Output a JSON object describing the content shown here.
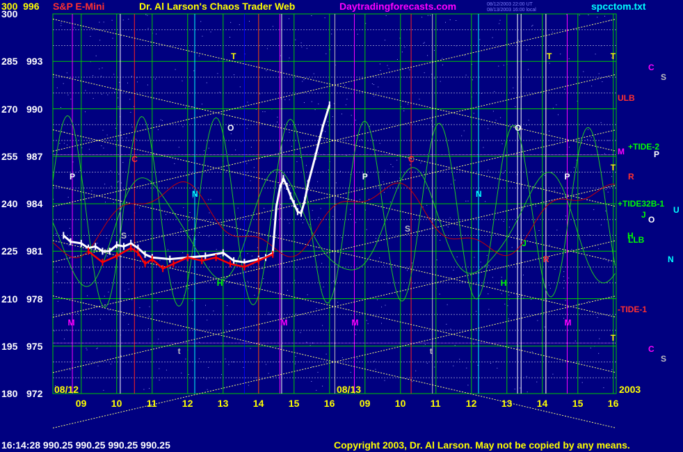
{
  "header": {
    "symbol": "S&P E-Mini",
    "title": "Dr. Al Larson's Chaos Trader Web",
    "site": "Daytradingforecasts.com",
    "stamp_line1": "08/12/2003 22:00 UT",
    "stamp_line2": "08/13/2003 16:00 local",
    "file": "spcctom.txt"
  },
  "footer": {
    "quote": "16:14:28 990.25 990.25 990.25 990.25",
    "copyright": "Copyright 2003, Dr. Al Larson. May not be copied by any means."
  },
  "colors": {
    "background": "#000080",
    "grid_green": "#00cc00",
    "diagonal_yellow": "#ffff80",
    "price_bars": "#ffffff",
    "average_yellow": "#ffff00",
    "red_price": "#ff0000",
    "tide_green": "#22cc22",
    "red_flux": "#cc0000"
  },
  "chart_data": {
    "type": "line",
    "y_left_labels": [
      "300",
      "285",
      "270",
      "255",
      "240",
      "225",
      "210",
      "195",
      "180"
    ],
    "y_right_labels": [
      "996",
      "993",
      "990",
      "987",
      "984",
      "981",
      "978",
      "975",
      "972"
    ],
    "ylim": [
      972,
      996
    ],
    "x_hour_labels": [
      "09",
      "10",
      "11",
      "12",
      "13",
      "14",
      "15",
      "16",
      "09",
      "10",
      "11",
      "12",
      "13",
      "14",
      "15",
      "16"
    ],
    "date_labels": [
      "08/12",
      "08/13"
    ],
    "year_label": "2003",
    "series": [
      {
        "color": "#ffffff",
        "x": [
          8.5,
          8.7,
          9.0,
          9.2,
          9.4,
          9.6,
          9.8,
          10.0,
          10.2,
          10.4,
          10.6,
          10.8,
          11.0,
          11.5,
          12.0,
          12.5,
          13.0,
          13.3,
          13.6,
          14.0,
          14.2,
          14.4,
          14.5,
          14.6,
          14.7,
          14.8,
          14.9,
          15.0,
          15.1,
          15.2,
          15.3,
          15.4,
          15.6,
          15.8,
          16.0
        ],
        "y": [
          982.0,
          981.6,
          981.5,
          981.2,
          981.3,
          981.0,
          981.0,
          981.4,
          981.3,
          981.5,
          981.2,
          980.8,
          980.6,
          980.5,
          980.6,
          980.7,
          980.9,
          980.4,
          980.3,
          980.5,
          980.6,
          980.9,
          983.8,
          985.0,
          985.6,
          985.1,
          984.5,
          984.0,
          983.5,
          983.4,
          984.2,
          985.3,
          987.0,
          988.8,
          990.25
        ]
      },
      {
        "color": "#ff0000",
        "x": [
          9.2,
          9.6,
          10.0,
          10.4,
          10.6,
          10.8,
          11.0,
          11.3,
          11.6,
          12.0,
          12.4,
          12.8,
          13.2,
          13.6,
          14.0,
          14.4
        ],
        "y": [
          981.0,
          980.3,
          980.7,
          981.2,
          980.9,
          980.2,
          980.5,
          979.9,
          980.2,
          980.6,
          980.4,
          980.6,
          980.2,
          980.0,
          980.4,
          980.8
        ]
      }
    ],
    "letter_labels": [
      {
        "text": "P",
        "x": 8.75,
        "y": 985.7,
        "color": "#ffffff"
      },
      {
        "text": "C",
        "x": 10.5,
        "y": 986.8,
        "color": "#ff3030"
      },
      {
        "text": "S",
        "x": 10.2,
        "y": 982.0,
        "color": "#c0c0c0"
      },
      {
        "text": "N",
        "x": 12.2,
        "y": 984.6,
        "color": "#00ffff"
      },
      {
        "text": "O",
        "x": 13.2,
        "y": 988.8,
        "color": "#ffffff"
      },
      {
        "text": "T",
        "x": 13.3,
        "y": 993.3,
        "color": "#ffff00"
      },
      {
        "text": "H",
        "x": 12.9,
        "y": 979.0,
        "color": "#00ff00"
      },
      {
        "text": "M",
        "x": 8.7,
        "y": 976.5,
        "color": "#ff00ff"
      },
      {
        "text": "M",
        "x": 14.7,
        "y": 976.5,
        "color": "#ff00ff"
      },
      {
        "text": "t",
        "x": 11.8,
        "y": 974.7,
        "color": "#c0c0c0"
      },
      {
        "text": "P",
        "x": 17.0,
        "y": 985.7,
        "color": "#ffffff"
      },
      {
        "text": "C",
        "x": 18.3,
        "y": 986.8,
        "color": "#ff3030"
      },
      {
        "text": "S",
        "x": 18.2,
        "y": 982.4,
        "color": "#c0c0c0"
      },
      {
        "text": "N",
        "x": 20.2,
        "y": 984.6,
        "color": "#00ffff"
      },
      {
        "text": "O",
        "x": 21.3,
        "y": 988.8,
        "color": "#ffffff"
      },
      {
        "text": "T",
        "x": 22.2,
        "y": 993.3,
        "color": "#ffff00"
      },
      {
        "text": "P",
        "x": 22.7,
        "y": 985.7,
        "color": "#ffffff"
      },
      {
        "text": "J",
        "x": 21.5,
        "y": 981.5,
        "color": "#00ff00"
      },
      {
        "text": "H",
        "x": 20.9,
        "y": 979.0,
        "color": "#00ff00"
      },
      {
        "text": "M",
        "x": 16.7,
        "y": 976.5,
        "color": "#ff00ff"
      },
      {
        "text": "M",
        "x": 22.7,
        "y": 976.5,
        "color": "#ff00ff"
      },
      {
        "text": "t",
        "x": 18.9,
        "y": 974.7,
        "color": "#c0c0c0"
      },
      {
        "text": "R",
        "x": 22.1,
        "y": 980.5,
        "color": "#ff3030"
      },
      {
        "text": "T",
        "x": 24.0,
        "y": 993.3,
        "color": "#ffff00"
      },
      {
        "text": "T",
        "x": 24.0,
        "y": 986.3,
        "color": "#ffff00"
      },
      {
        "text": "T",
        "x": 24.0,
        "y": 975.5,
        "color": "#ffff00"
      }
    ],
    "right_labels": [
      {
        "text": "ULB",
        "y": 990.7,
        "color": "#ff3030"
      },
      {
        "text": "+TIDE-2",
        "y": 987.6,
        "color": "#00ff00"
      },
      {
        "text": "M",
        "y": 987.3,
        "color": "#ff00ff"
      },
      {
        "text": "R",
        "y": 985.7,
        "color": "#ff3030"
      },
      {
        "text": "+TIDE32B-1",
        "y": 984.0,
        "color": "#00ff00"
      },
      {
        "text": "LLB",
        "y": 981.7,
        "color": "#00ff00"
      },
      {
        "text": "-TIDE-1",
        "y": 977.3,
        "color": "#ff3030"
      }
    ],
    "far_right_labels": [
      {
        "text": "C",
        "y": 992.6,
        "color": "#ff00ff"
      },
      {
        "text": "S",
        "y": 992.0,
        "color": "#c0c0c0"
      },
      {
        "text": "P",
        "y": 987.1,
        "color": "#ffffff"
      },
      {
        "text": "J",
        "y": 983.3,
        "color": "#00ff00"
      },
      {
        "text": "O",
        "y": 983.0,
        "color": "#ffffff"
      },
      {
        "text": "U",
        "y": 983.6,
        "color": "#00ffff"
      },
      {
        "text": "H",
        "y": 982.0,
        "color": "#00ff00"
      },
      {
        "text": "N",
        "y": 980.5,
        "color": "#00ffff"
      },
      {
        "text": "C",
        "y": 974.8,
        "color": "#ff00ff"
      },
      {
        "text": "S",
        "y": 974.2,
        "color": "#c0c0c0"
      }
    ]
  }
}
